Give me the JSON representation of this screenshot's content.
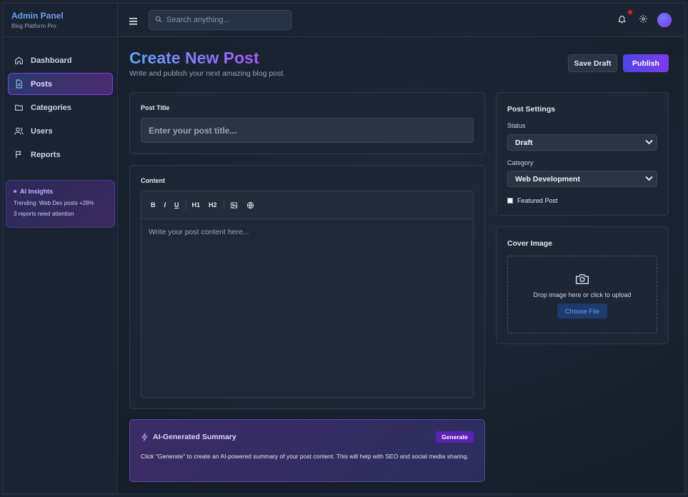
{
  "brand": {
    "title": "Admin Panel",
    "subtitle": "Blog Platform Pro"
  },
  "sidebar": {
    "items": [
      {
        "label": "Dashboard",
        "icon": "home-icon"
      },
      {
        "label": "Posts",
        "icon": "document-icon",
        "active": true
      },
      {
        "label": "Categories",
        "icon": "folder-icon"
      },
      {
        "label": "Users",
        "icon": "users-icon"
      },
      {
        "label": "Reports",
        "icon": "flag-icon"
      }
    ],
    "insights": {
      "title": "AI Insights",
      "line1": "Trending: Web Dev posts +28%",
      "line2": "3 reports need attention"
    }
  },
  "topbar": {
    "search": {
      "placeholder": "Search anything..."
    },
    "icons": [
      "menu-icon",
      "bell-icon",
      "gear-icon",
      "avatar"
    ]
  },
  "page": {
    "title": "Create New Post",
    "subtitle": "Write and publish your next amazing blog post.",
    "save_draft_label": "Save Draft",
    "publish_label": "Publish"
  },
  "editor": {
    "title_label": "Post Title",
    "title_placeholder": "Enter your post title...",
    "content_label": "Content",
    "toolbar": [
      "B",
      "I",
      "U",
      "H1",
      "H2"
    ],
    "toolbar_icons": [
      "image-icon",
      "link-icon"
    ],
    "content_placeholder": "Write your post content here..."
  },
  "summary": {
    "title": "AI-Generated Summary",
    "generate_label": "Generate",
    "text": "Click \"Generate\" to create an AI-powered summary of your post content. This will help with SEO and social media sharing."
  },
  "settings": {
    "title": "Post Settings",
    "status_label": "Status",
    "status_value": "Draft",
    "category_label": "Category",
    "category_value": "Web Development",
    "featured_label": "Featured Post",
    "featured_checked": false
  },
  "cover": {
    "title": "Cover Image",
    "drop_text": "Drop image here or click to upload",
    "choose_label": "Choose File"
  },
  "colors": {
    "accent_gradient_start": "#4f46e5",
    "accent_gradient_end": "#7c3aed",
    "notification": "#dc2626",
    "link_blue": "#60a5fa"
  }
}
